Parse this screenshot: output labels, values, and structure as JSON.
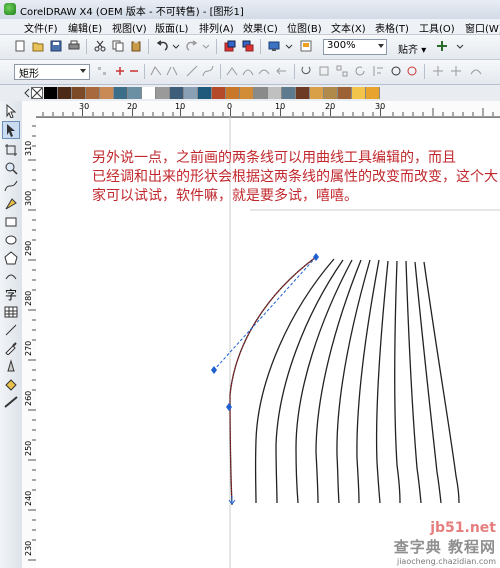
{
  "window": {
    "title": "CorelDRAW X4 (OEM 版本 - 不可转售) - [图形1]"
  },
  "menu": {
    "items": [
      "文件(F)",
      "编辑(E)",
      "视图(V)",
      "版面(L)",
      "排列(A)",
      "效果(C)",
      "位图(B)",
      "文本(X)",
      "表格(T)",
      "工具(O)",
      "窗口(W)"
    ]
  },
  "toolbar": {
    "zoom_value": "300%",
    "snap_label": "贴齐"
  },
  "property_bar": {
    "shape_type": "矩形"
  },
  "palette": {
    "colors": [
      "#000000",
      "#4b2a18",
      "#7d4a28",
      "#a86a3c",
      "#c98a55",
      "#3c6e89",
      "#6b8fa3",
      "#ffffff",
      "#9a9a9a",
      "#3d5d7a",
      "#8aa1b5",
      "#1f5a7c",
      "#b44a2a",
      "#c9782a",
      "#d28b36",
      "#8a8a8a",
      "#c0c0c0",
      "#5e7a8f",
      "#6d3b24",
      "#d9a047",
      "#b08a4a",
      "#9c6236",
      "#f2c44a",
      "#e8a32e"
    ]
  },
  "rulers": {
    "horizontal": [
      "30",
      "20",
      "10",
      "0",
      "10",
      "20",
      "30"
    ],
    "vertical": [
      "310",
      "300",
      "290",
      "280",
      "270",
      "260",
      "250",
      "240",
      "230"
    ]
  },
  "canvas": {
    "note_line1": "另外说一点，之前画的两条线可以用曲线工具编辑的，而且",
    "note_line2": "已经调和出来的形状会根据这两条线的属性的改变而改变，这个大家可以试试，软件嘛，就是要多试，嘻嘻。"
  },
  "watermark": {
    "site": "jb51.net",
    "name": "查字典 教程网",
    "url": "jiaocheng.chazidian.com"
  },
  "colors": {
    "annotation_text": "#c0282d",
    "node_marker": "#1e5fd1"
  }
}
